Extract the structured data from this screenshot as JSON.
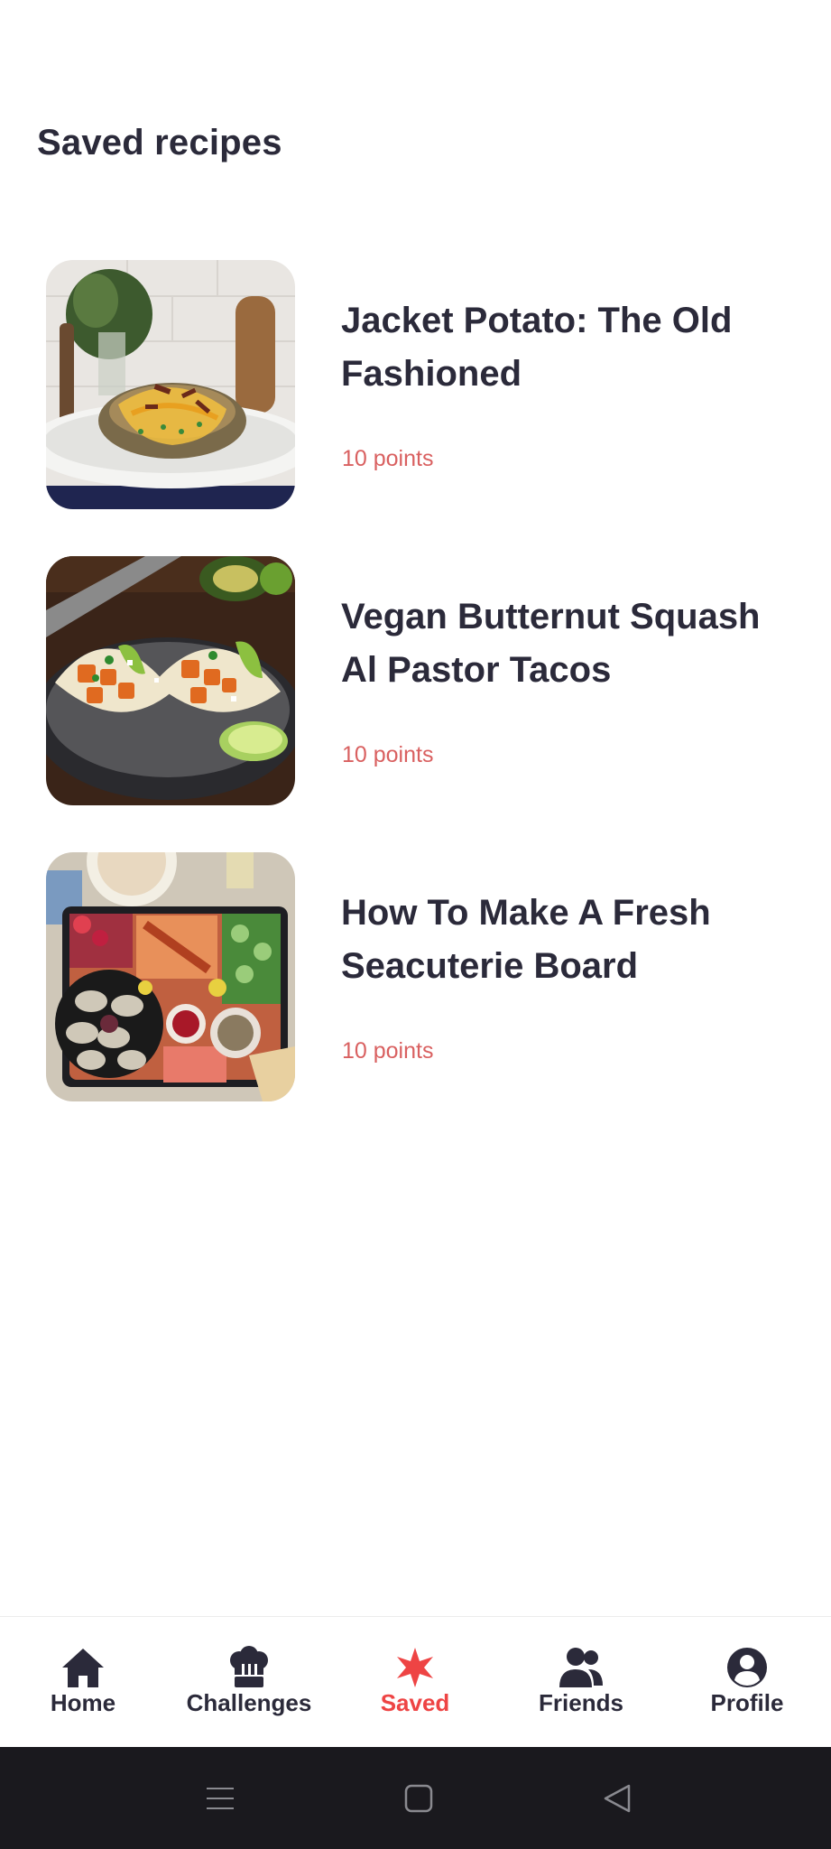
{
  "page": {
    "title": "Saved recipes"
  },
  "recipes": [
    {
      "title": "Jacket Potato: The Old Fashioned",
      "points": "10 points"
    },
    {
      "title": "Vegan Butternut Squash Al Pastor Tacos",
      "points": "10 points"
    },
    {
      "title": "How To Make A Fresh Seacuterie Board",
      "points": "10 points"
    }
  ],
  "tabs": [
    {
      "label": "Home",
      "icon": "home-icon"
    },
    {
      "label": "Challenges",
      "icon": "chef-hat-icon"
    },
    {
      "label": "Saved",
      "icon": "star-icon",
      "active": true
    },
    {
      "label": "Friends",
      "icon": "friends-icon"
    },
    {
      "label": "Profile",
      "icon": "profile-icon"
    }
  ],
  "system_nav": {
    "buttons": [
      "recents-icon",
      "home-square-icon",
      "back-triangle-icon"
    ]
  },
  "colors": {
    "text": "#2b2a3a",
    "points": "#d96060",
    "active_tab": "#ee4444",
    "system_bar": "#1a191e"
  }
}
